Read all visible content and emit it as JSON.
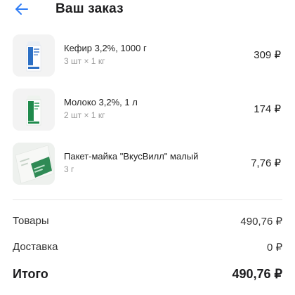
{
  "header": {
    "title": "Ваш заказ",
    "back_icon": "arrow-left-icon",
    "accent_color": "#2f7df6"
  },
  "items": [
    {
      "name": "Кефир 3,2%, 1000 г",
      "qty": "3 шт × 1 кг",
      "price": "309 ₽",
      "thumbnail": "kefir-carton-image"
    },
    {
      "name": "Молоко 3,2%, 1 л",
      "qty": "2 шт × 1 кг",
      "price": "174 ₽",
      "thumbnail": "milk-carton-image"
    },
    {
      "name": "Пакет-майка \"ВкусВилл\" малый",
      "qty": "3 г",
      "price": "7,76 ₽",
      "thumbnail": "shopping-bag-image"
    }
  ],
  "summary": {
    "goods_label": "Товары",
    "goods_value": "490,76 ₽",
    "delivery_label": "Доставка",
    "delivery_value": "0 ₽",
    "total_label": "Итого",
    "total_value": "490,76 ₽"
  }
}
